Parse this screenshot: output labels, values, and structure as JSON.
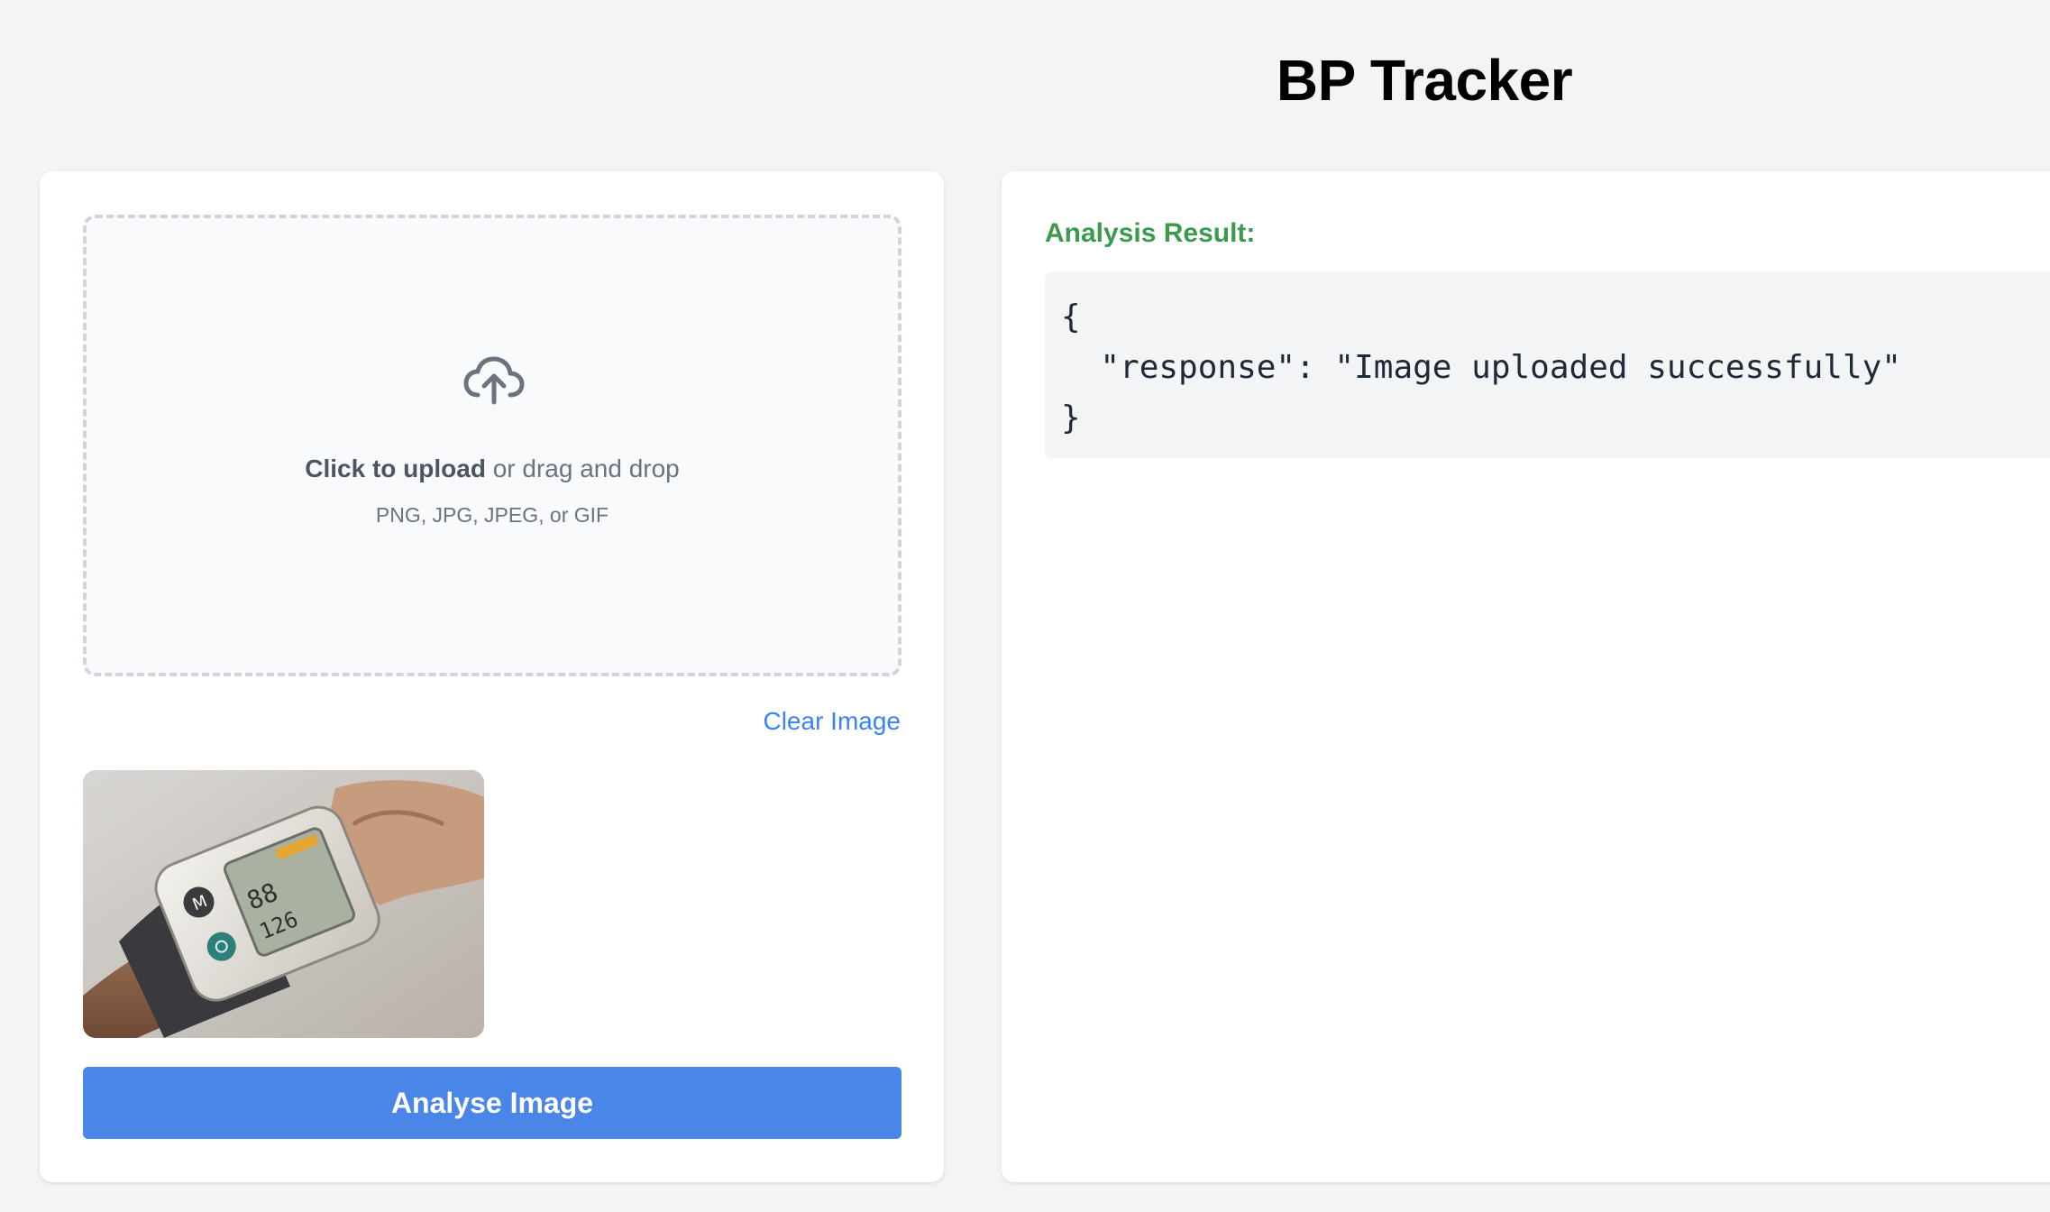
{
  "header": {
    "title": "BP Tracker"
  },
  "upload": {
    "icon": "cloud-upload-icon",
    "click_label": "Click to upload",
    "drag_label": " or drag and drop",
    "hint": "PNG, JPG, JPEG, or GIF",
    "clear_label": "Clear Image",
    "preview_subject": "wrist blood pressure monitor"
  },
  "actions": {
    "analyse_label": "Analyse Image"
  },
  "result": {
    "label": "Analysis Result:",
    "json_text": "{\n  \"response\": \"Image uploaded successfully\"\n}"
  },
  "colors": {
    "page_background": "#f3f4f6",
    "card_background": "#ffffff",
    "primary_button": "#4a86e8",
    "link": "#3b82f6",
    "result_label": "#3c9a4e",
    "code_background": "#f3f4f6"
  }
}
